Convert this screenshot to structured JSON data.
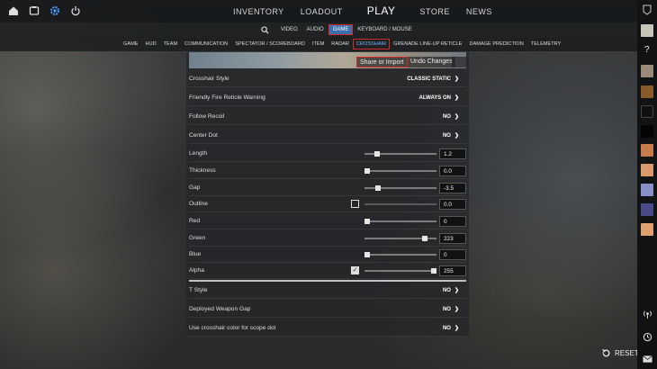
{
  "topnav": {
    "items": [
      {
        "label": "INVENTORY"
      },
      {
        "label": "LOADOUT"
      },
      {
        "label": "PLAY"
      },
      {
        "label": "STORE"
      },
      {
        "label": "NEWS"
      }
    ]
  },
  "subnav": {
    "items": [
      {
        "label": "VIDEO"
      },
      {
        "label": "AUDIO"
      },
      {
        "label": "GAME",
        "active": true
      },
      {
        "label": "KEYBOARD / MOUSE"
      }
    ]
  },
  "tabs": {
    "items": [
      {
        "label": "GAME"
      },
      {
        "label": "HUD"
      },
      {
        "label": "TEAM"
      },
      {
        "label": "COMMUNICATION"
      },
      {
        "label": "SPECTATOR / SCOREBOARD"
      },
      {
        "label": "ITEM"
      },
      {
        "label": "RADAR"
      },
      {
        "label": "CROSSHAIR",
        "active": true
      },
      {
        "label": "GRENADE LINE-UP RETICLE"
      },
      {
        "label": "DAMAGE PREDICTION"
      },
      {
        "label": "TELEMETRY"
      }
    ]
  },
  "preview": {
    "share_import": "Share or Import",
    "undo": "Undo Changes"
  },
  "settings": {
    "crosshair_style": {
      "label": "Crosshair Style",
      "value": "CLASSIC STATIC"
    },
    "friendly_fire": {
      "label": "Friendly Fire Reticle Warning",
      "value": "ALWAYS ON"
    },
    "follow_recoil": {
      "label": "Follow Recoil",
      "value": "NO"
    },
    "center_dot": {
      "label": "Center Dot",
      "value": "NO"
    },
    "length": {
      "label": "Length",
      "value": "1.2",
      "fraction": 0.15
    },
    "thickness": {
      "label": "Thickness",
      "value": "0.0",
      "fraction": 0.0
    },
    "gap": {
      "label": "Gap",
      "value": "-3.5",
      "fraction": 0.16
    },
    "outline": {
      "label": "Outline",
      "value": "0.0",
      "fraction": 0.0
    },
    "red": {
      "label": "Red",
      "value": "0",
      "fraction": 0.0
    },
    "green": {
      "label": "Green",
      "value": "223",
      "fraction": 0.87
    },
    "blue": {
      "label": "Blue",
      "value": "0",
      "fraction": 0.0
    },
    "alpha": {
      "label": "Alpha",
      "value": "255",
      "fraction": 1.0
    },
    "t_style": {
      "label": "T Style",
      "value": "NO"
    },
    "deployed_gap": {
      "label": "Deployed Weapon Gap",
      "value": "NO"
    },
    "scope_dot": {
      "label": "Use crosshair color for scope dot",
      "value": "NO"
    }
  },
  "reset_label": "RESET",
  "colors": {
    "accent_red": "#d02a2a",
    "active_blue": "#3d6fae",
    "tab_blue": "#6fb6ff"
  }
}
